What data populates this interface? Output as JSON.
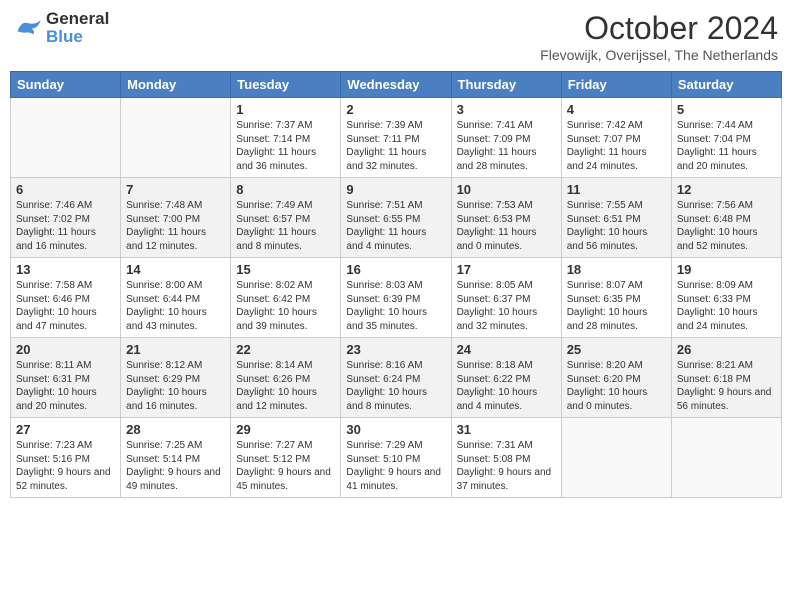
{
  "header": {
    "logo_general": "General",
    "logo_blue": "Blue",
    "month_title": "October 2024",
    "subtitle": "Flevowijk, Overijssel, The Netherlands"
  },
  "days_of_week": [
    "Sunday",
    "Monday",
    "Tuesday",
    "Wednesday",
    "Thursday",
    "Friday",
    "Saturday"
  ],
  "weeks": [
    [
      {
        "day": "",
        "empty": true
      },
      {
        "day": "",
        "empty": true
      },
      {
        "day": "1",
        "sunrise": "Sunrise: 7:37 AM",
        "sunset": "Sunset: 7:14 PM",
        "daylight": "Daylight: 11 hours and 36 minutes."
      },
      {
        "day": "2",
        "sunrise": "Sunrise: 7:39 AM",
        "sunset": "Sunset: 7:11 PM",
        "daylight": "Daylight: 11 hours and 32 minutes."
      },
      {
        "day": "3",
        "sunrise": "Sunrise: 7:41 AM",
        "sunset": "Sunset: 7:09 PM",
        "daylight": "Daylight: 11 hours and 28 minutes."
      },
      {
        "day": "4",
        "sunrise": "Sunrise: 7:42 AM",
        "sunset": "Sunset: 7:07 PM",
        "daylight": "Daylight: 11 hours and 24 minutes."
      },
      {
        "day": "5",
        "sunrise": "Sunrise: 7:44 AM",
        "sunset": "Sunset: 7:04 PM",
        "daylight": "Daylight: 11 hours and 20 minutes."
      }
    ],
    [
      {
        "day": "6",
        "sunrise": "Sunrise: 7:46 AM",
        "sunset": "Sunset: 7:02 PM",
        "daylight": "Daylight: 11 hours and 16 minutes."
      },
      {
        "day": "7",
        "sunrise": "Sunrise: 7:48 AM",
        "sunset": "Sunset: 7:00 PM",
        "daylight": "Daylight: 11 hours and 12 minutes."
      },
      {
        "day": "8",
        "sunrise": "Sunrise: 7:49 AM",
        "sunset": "Sunset: 6:57 PM",
        "daylight": "Daylight: 11 hours and 8 minutes."
      },
      {
        "day": "9",
        "sunrise": "Sunrise: 7:51 AM",
        "sunset": "Sunset: 6:55 PM",
        "daylight": "Daylight: 11 hours and 4 minutes."
      },
      {
        "day": "10",
        "sunrise": "Sunrise: 7:53 AM",
        "sunset": "Sunset: 6:53 PM",
        "daylight": "Daylight: 11 hours and 0 minutes."
      },
      {
        "day": "11",
        "sunrise": "Sunrise: 7:55 AM",
        "sunset": "Sunset: 6:51 PM",
        "daylight": "Daylight: 10 hours and 56 minutes."
      },
      {
        "day": "12",
        "sunrise": "Sunrise: 7:56 AM",
        "sunset": "Sunset: 6:48 PM",
        "daylight": "Daylight: 10 hours and 52 minutes."
      }
    ],
    [
      {
        "day": "13",
        "sunrise": "Sunrise: 7:58 AM",
        "sunset": "Sunset: 6:46 PM",
        "daylight": "Daylight: 10 hours and 47 minutes."
      },
      {
        "day": "14",
        "sunrise": "Sunrise: 8:00 AM",
        "sunset": "Sunset: 6:44 PM",
        "daylight": "Daylight: 10 hours and 43 minutes."
      },
      {
        "day": "15",
        "sunrise": "Sunrise: 8:02 AM",
        "sunset": "Sunset: 6:42 PM",
        "daylight": "Daylight: 10 hours and 39 minutes."
      },
      {
        "day": "16",
        "sunrise": "Sunrise: 8:03 AM",
        "sunset": "Sunset: 6:39 PM",
        "daylight": "Daylight: 10 hours and 35 minutes."
      },
      {
        "day": "17",
        "sunrise": "Sunrise: 8:05 AM",
        "sunset": "Sunset: 6:37 PM",
        "daylight": "Daylight: 10 hours and 32 minutes."
      },
      {
        "day": "18",
        "sunrise": "Sunrise: 8:07 AM",
        "sunset": "Sunset: 6:35 PM",
        "daylight": "Daylight: 10 hours and 28 minutes."
      },
      {
        "day": "19",
        "sunrise": "Sunrise: 8:09 AM",
        "sunset": "Sunset: 6:33 PM",
        "daylight": "Daylight: 10 hours and 24 minutes."
      }
    ],
    [
      {
        "day": "20",
        "sunrise": "Sunrise: 8:11 AM",
        "sunset": "Sunset: 6:31 PM",
        "daylight": "Daylight: 10 hours and 20 minutes."
      },
      {
        "day": "21",
        "sunrise": "Sunrise: 8:12 AM",
        "sunset": "Sunset: 6:29 PM",
        "daylight": "Daylight: 10 hours and 16 minutes."
      },
      {
        "day": "22",
        "sunrise": "Sunrise: 8:14 AM",
        "sunset": "Sunset: 6:26 PM",
        "daylight": "Daylight: 10 hours and 12 minutes."
      },
      {
        "day": "23",
        "sunrise": "Sunrise: 8:16 AM",
        "sunset": "Sunset: 6:24 PM",
        "daylight": "Daylight: 10 hours and 8 minutes."
      },
      {
        "day": "24",
        "sunrise": "Sunrise: 8:18 AM",
        "sunset": "Sunset: 6:22 PM",
        "daylight": "Daylight: 10 hours and 4 minutes."
      },
      {
        "day": "25",
        "sunrise": "Sunrise: 8:20 AM",
        "sunset": "Sunset: 6:20 PM",
        "daylight": "Daylight: 10 hours and 0 minutes."
      },
      {
        "day": "26",
        "sunrise": "Sunrise: 8:21 AM",
        "sunset": "Sunset: 6:18 PM",
        "daylight": "Daylight: 9 hours and 56 minutes."
      }
    ],
    [
      {
        "day": "27",
        "sunrise": "Sunrise: 7:23 AM",
        "sunset": "Sunset: 5:16 PM",
        "daylight": "Daylight: 9 hours and 52 minutes."
      },
      {
        "day": "28",
        "sunrise": "Sunrise: 7:25 AM",
        "sunset": "Sunset: 5:14 PM",
        "daylight": "Daylight: 9 hours and 49 minutes."
      },
      {
        "day": "29",
        "sunrise": "Sunrise: 7:27 AM",
        "sunset": "Sunset: 5:12 PM",
        "daylight": "Daylight: 9 hours and 45 minutes."
      },
      {
        "day": "30",
        "sunrise": "Sunrise: 7:29 AM",
        "sunset": "Sunset: 5:10 PM",
        "daylight": "Daylight: 9 hours and 41 minutes."
      },
      {
        "day": "31",
        "sunrise": "Sunrise: 7:31 AM",
        "sunset": "Sunset: 5:08 PM",
        "daylight": "Daylight: 9 hours and 37 minutes."
      },
      {
        "day": "",
        "empty": true
      },
      {
        "day": "",
        "empty": true
      }
    ]
  ]
}
